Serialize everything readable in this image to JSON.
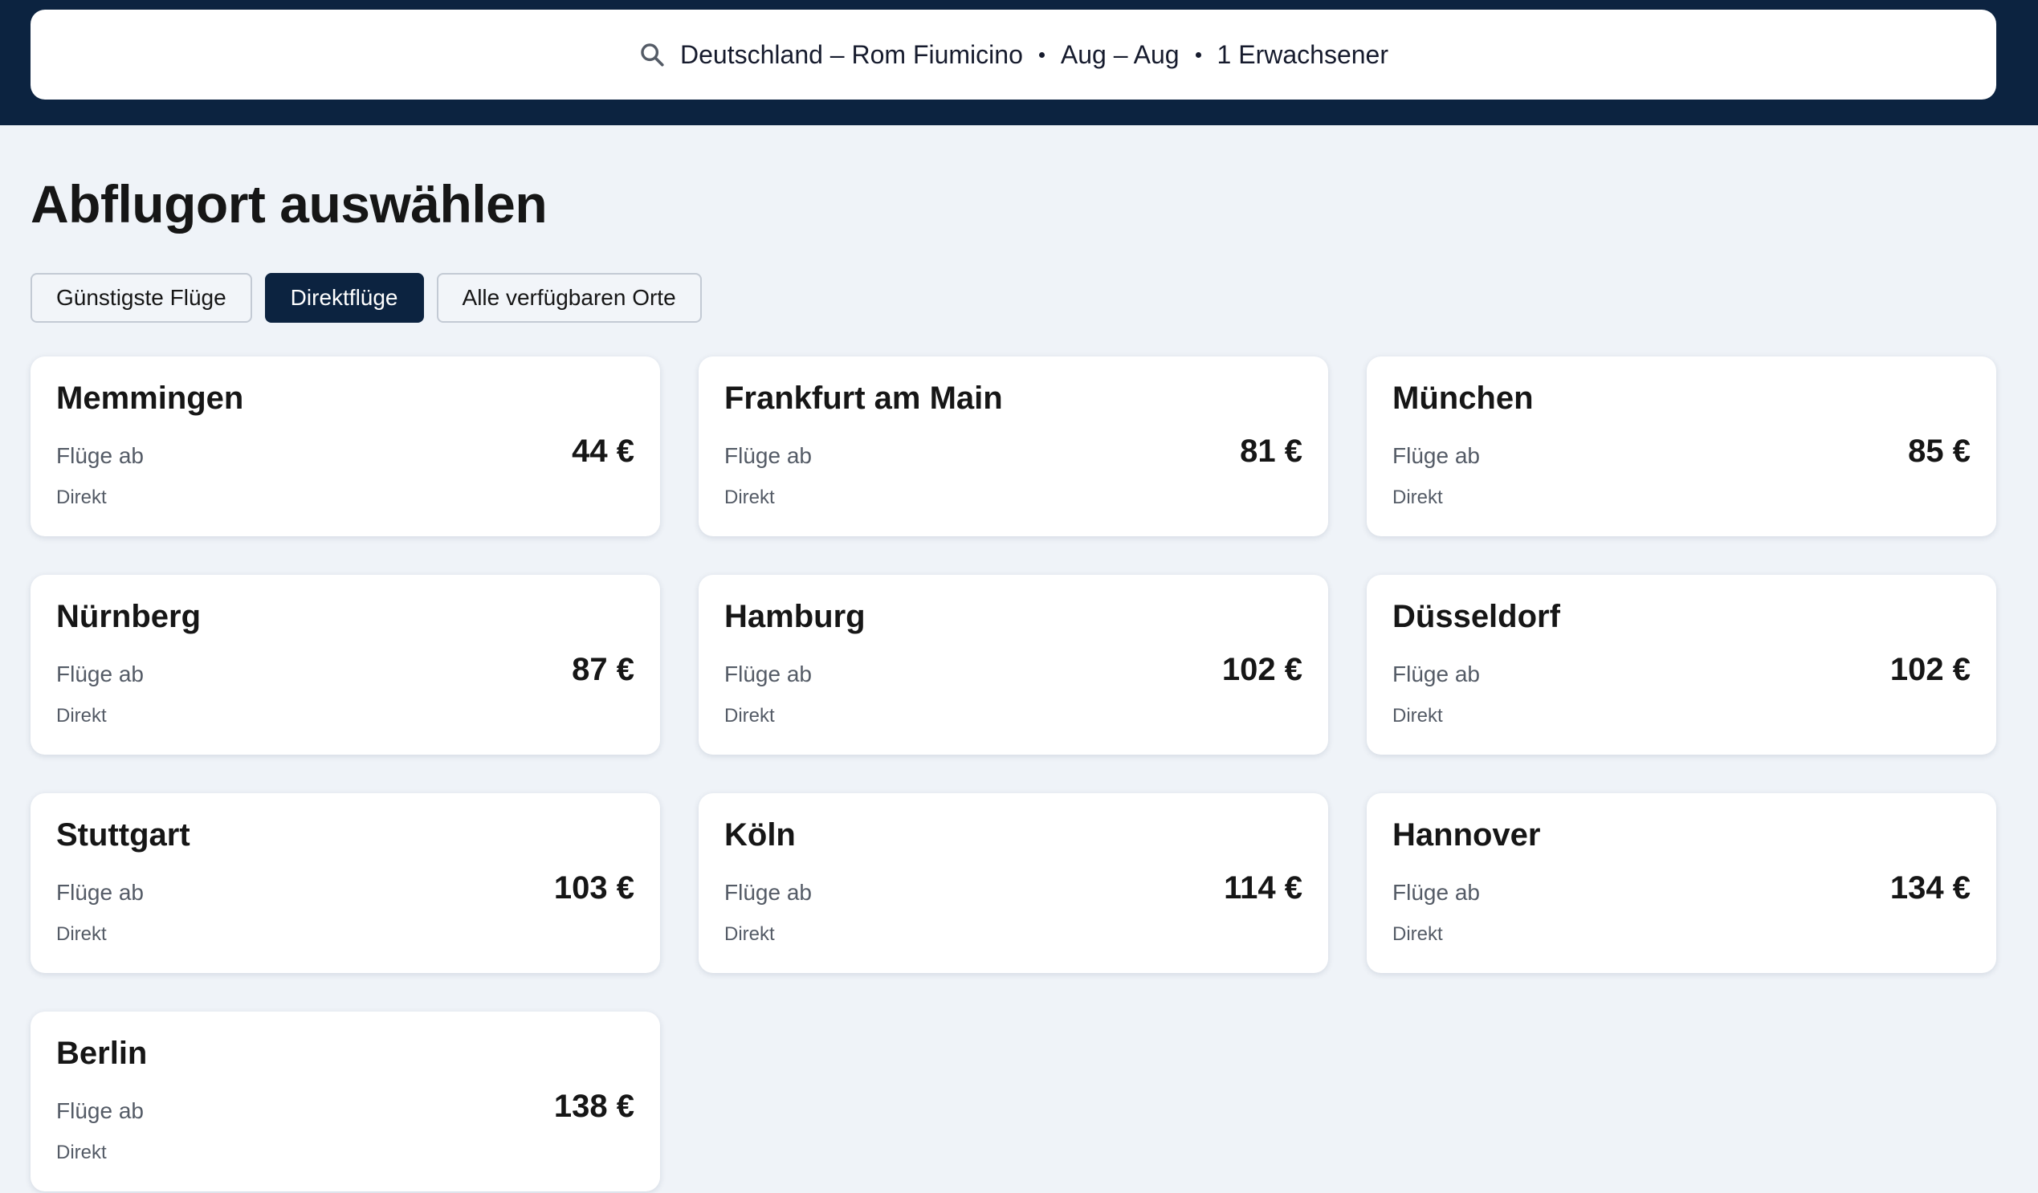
{
  "search": {
    "route": "Deutschland – Rom Fiumicino",
    "dates": "Aug – Aug",
    "passengers": "1 Erwachsener"
  },
  "page": {
    "title": "Abflugort auswählen"
  },
  "filters": [
    {
      "label": "Günstigste Flüge",
      "active": false
    },
    {
      "label": "Direktflüge",
      "active": true
    },
    {
      "label": "Alle verfügbaren Orte",
      "active": false
    }
  ],
  "destinations": [
    {
      "city": "Memmingen",
      "from_label": "Flüge ab",
      "price": "44 €",
      "stops": "Direkt"
    },
    {
      "city": "Frankfurt am Main",
      "from_label": "Flüge ab",
      "price": "81 €",
      "stops": "Direkt"
    },
    {
      "city": "München",
      "from_label": "Flüge ab",
      "price": "85 €",
      "stops": "Direkt"
    },
    {
      "city": "Nürnberg",
      "from_label": "Flüge ab",
      "price": "87 €",
      "stops": "Direkt"
    },
    {
      "city": "Hamburg",
      "from_label": "Flüge ab",
      "price": "102 €",
      "stops": "Direkt"
    },
    {
      "city": "Düsseldorf",
      "from_label": "Flüge ab",
      "price": "102 €",
      "stops": "Direkt"
    },
    {
      "city": "Stuttgart",
      "from_label": "Flüge ab",
      "price": "103 €",
      "stops": "Direkt"
    },
    {
      "city": "Köln",
      "from_label": "Flüge ab",
      "price": "114 €",
      "stops": "Direkt"
    },
    {
      "city": "Hannover",
      "from_label": "Flüge ab",
      "price": "134 €",
      "stops": "Direkt"
    },
    {
      "city": "Berlin",
      "from_label": "Flüge ab",
      "price": "138 €",
      "stops": "Direkt"
    }
  ],
  "colors": {
    "header_bg": "#0c2340",
    "page_bg": "#eff3f8",
    "active_chip": "#0c2340"
  }
}
